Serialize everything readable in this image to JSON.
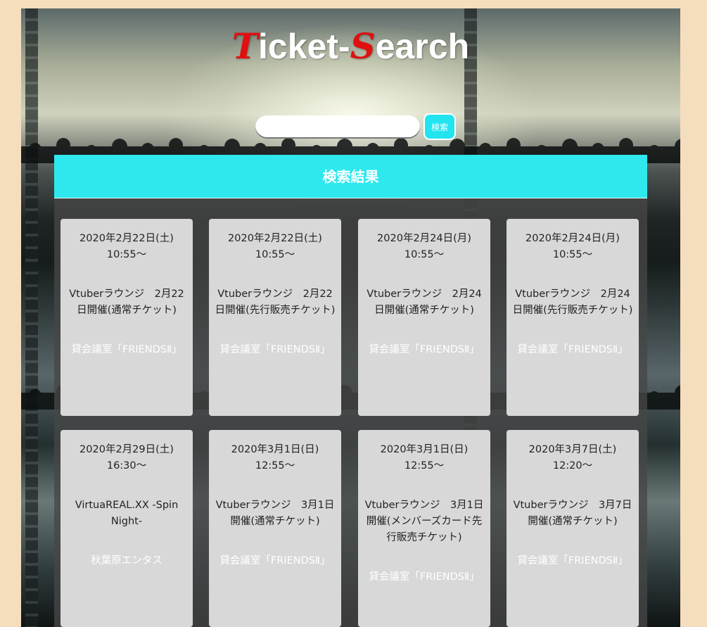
{
  "logo": {
    "t_letter": "T",
    "part1": "icket-",
    "s_letter": "S",
    "part2": "earch"
  },
  "search": {
    "placeholder": "",
    "value": "",
    "button_label": "検索"
  },
  "results": {
    "heading": "検索結果",
    "events": [
      {
        "date": "2020年2月22日(土)",
        "time": "10:55～",
        "title": "Vtuberラウンジ　2月22日開催(通常チケット)",
        "venue": "貸会議室「FRIENDSⅡ」"
      },
      {
        "date": "2020年2月22日(土)",
        "time": "10:55～",
        "title": "Vtuberラウンジ　2月22日開催(先行販売チケット)",
        "venue": "貸会議室「FRIENDSⅡ」"
      },
      {
        "date": "2020年2月24日(月)",
        "time": "10:55～",
        "title": "Vtuberラウンジ　2月24日開催(通常チケット)",
        "venue": "貸会議室「FRIENDSⅡ」"
      },
      {
        "date": "2020年2月24日(月)",
        "time": "10:55～",
        "title": "Vtuberラウンジ　2月24日開催(先行販売チケット)",
        "venue": "貸会議室「FRIENDSⅡ」"
      },
      {
        "date": "2020年2月29日(土)",
        "time": "16:30～",
        "title": "VirtuaREAL.XX -Spin Night-",
        "venue": "秋葉原エンタス"
      },
      {
        "date": "2020年3月1日(日)",
        "time": "12:55～",
        "title": "Vtuberラウンジ　3月1日開催(通常チケット)",
        "venue": "貸会議室「FRIENDSⅡ」"
      },
      {
        "date": "2020年3月1日(日)",
        "time": "12:55～",
        "title": "Vtuberラウンジ　3月1日開催(メンバーズカード先行販売チケット)",
        "venue": "貸会議室「FRIENDSⅡ」"
      },
      {
        "date": "2020年3月7日(土)",
        "time": "12:20～",
        "title": "Vtuberラウンジ　3月7日開催(通常チケット)",
        "venue": "貸会議室「FRIENDSⅡ」"
      }
    ]
  },
  "colors": {
    "page_background": "#f5debd",
    "accent_cyan": "#2ee8ee",
    "logo_red": "#e01010",
    "card_background": "#d8d8d8"
  }
}
